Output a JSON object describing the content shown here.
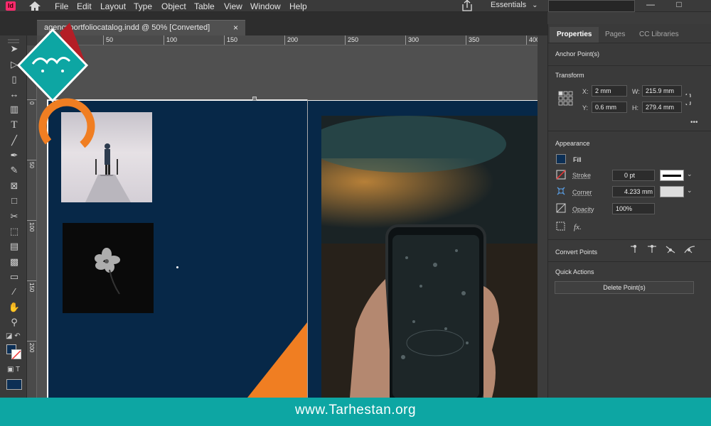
{
  "app": {
    "icon_label": "Id",
    "workspace": "Essentials"
  },
  "menu": [
    "File",
    "Edit",
    "Layout",
    "Type",
    "Object",
    "Table",
    "View",
    "Window",
    "Help"
  ],
  "window_controls": [
    "—",
    "□"
  ],
  "document_tab": {
    "title": "agencyportfoliocatalog.indd @ 50% [Converted]",
    "close": "×"
  },
  "ruler": {
    "horizontal": [
      "50",
      "100",
      "150",
      "200",
      "250",
      "300",
      "350",
      "400"
    ],
    "vertical": [
      "0",
      "50",
      "100",
      "150",
      "200"
    ]
  },
  "tools": [
    "selection-icon",
    "direct-selection-icon",
    "page-icon",
    "gap-icon",
    "content-collector-icon",
    "type-icon",
    "line-icon",
    "pen-icon",
    "pencil-icon",
    "rectangle-frame-icon",
    "rectangle-icon",
    "scissors-icon",
    "free-transform-icon",
    "gradient-icon",
    "gradient-feather-icon",
    "note-icon",
    "eyedropper-icon",
    "hand-icon",
    "zoom-icon"
  ],
  "properties_panel": {
    "tabs": [
      "Properties",
      "Pages",
      "CC Libraries"
    ],
    "anchor_label": "Anchor Point(s)",
    "transform": {
      "title": "Transform",
      "x_label": "X:",
      "x_value": "2 mm",
      "y_label": "Y:",
      "y_value": "0.6 mm",
      "w_label": "W:",
      "w_value": "215.9 mm",
      "h_label": "H:",
      "h_value": "279.4 mm",
      "more": "•••"
    },
    "appearance": {
      "title": "Appearance",
      "fill_label": "Fill",
      "stroke_label": "Stroke",
      "stroke_value": "0 pt",
      "corner_label": "Corner",
      "corner_value": "4.233 mm",
      "opacity_label": "Opacity",
      "opacity_value": "100%",
      "fx_label": "fx.",
      "fill_color": "#0c2f55",
      "stroke_color": "#000000"
    },
    "convert_points": {
      "title": "Convert Points"
    },
    "quick_actions": {
      "title": "Quick Actions",
      "button": "Delete Point(s)"
    }
  },
  "footer": {
    "url": "www.Tarhestan.org"
  },
  "colors": {
    "brand_teal": "#0da6a3",
    "accent_orange": "#f07e22",
    "page_navy": "#072848"
  }
}
